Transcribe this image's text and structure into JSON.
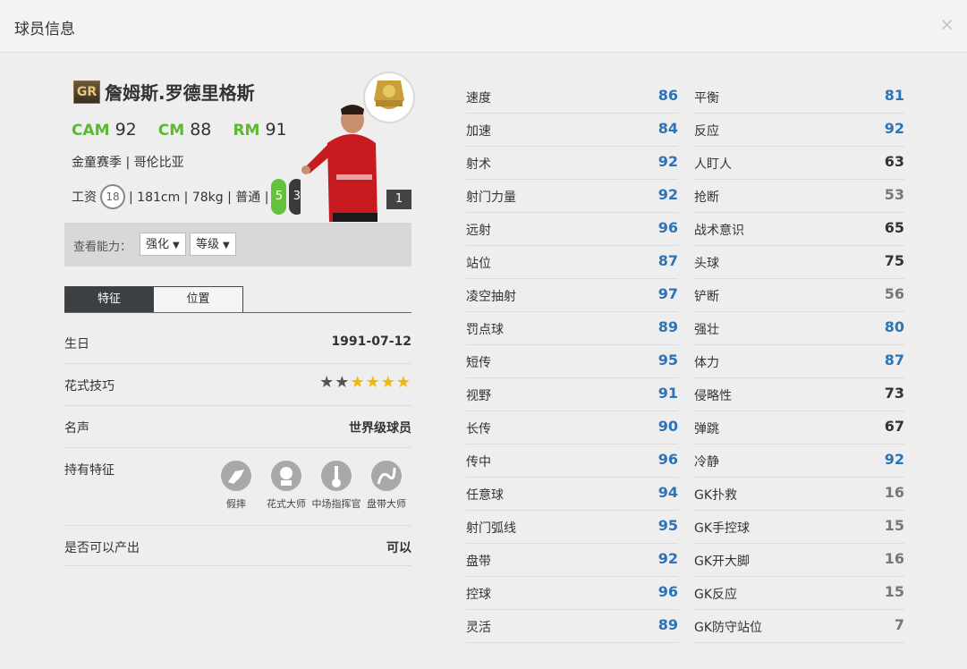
{
  "window": {
    "title": "球员信息",
    "close": "×"
  },
  "player": {
    "grade": "GR",
    "name": "詹姆斯.罗德里格斯",
    "positions": [
      {
        "code": "CAM",
        "value": "92"
      },
      {
        "code": "CM",
        "value": "88"
      },
      {
        "code": "RM",
        "value": "91"
      }
    ],
    "season_line": "金童赛季 | 哥伦比亚",
    "wage_label": "工资",
    "wage": "18",
    "body_line": "| 181cm | 78kg | 普通 |",
    "left_foot": "5",
    "right_foot": "3",
    "level": "1"
  },
  "ability": {
    "label": "查看能力：",
    "select1": "强化",
    "select2": "等级"
  },
  "tabs": {
    "active": "特征",
    "inactive": "位置"
  },
  "details": {
    "birthday_label": "生日",
    "birthday": "1991-07-12",
    "skill_label": "花式技巧",
    "skill_stars": 5,
    "skill_filled_dark": 2,
    "fame_label": "名声",
    "fame": "世界级球员",
    "traits_label": "持有特征",
    "traits": [
      "假摔",
      "花式大师",
      "中场指挥官",
      "盘带大师"
    ],
    "produce_label": "是否可以产出",
    "produce": "可以"
  },
  "stats_left": [
    {
      "name": "速度",
      "value": "86",
      "color": "blue"
    },
    {
      "name": "加速",
      "value": "84",
      "color": "blue"
    },
    {
      "name": "射术",
      "value": "92",
      "color": "blue"
    },
    {
      "name": "射门力量",
      "value": "92",
      "color": "blue"
    },
    {
      "name": "远射",
      "value": "96",
      "color": "blue"
    },
    {
      "name": "站位",
      "value": "87",
      "color": "blue"
    },
    {
      "name": "凌空抽射",
      "value": "97",
      "color": "blue"
    },
    {
      "name": "罚点球",
      "value": "89",
      "color": "blue"
    },
    {
      "name": "短传",
      "value": "95",
      "color": "blue"
    },
    {
      "name": "视野",
      "value": "91",
      "color": "blue"
    },
    {
      "name": "长传",
      "value": "90",
      "color": "blue"
    },
    {
      "name": "传中",
      "value": "96",
      "color": "blue"
    },
    {
      "name": "任意球",
      "value": "94",
      "color": "blue"
    },
    {
      "name": "射门弧线",
      "value": "95",
      "color": "blue"
    },
    {
      "name": "盘带",
      "value": "92",
      "color": "blue"
    },
    {
      "name": "控球",
      "value": "96",
      "color": "blue"
    },
    {
      "name": "灵活",
      "value": "89",
      "color": "blue"
    }
  ],
  "stats_right": [
    {
      "name": "平衡",
      "value": "81",
      "color": "blue"
    },
    {
      "name": "反应",
      "value": "92",
      "color": "blue"
    },
    {
      "name": "人盯人",
      "value": "63",
      "color": "black"
    },
    {
      "name": "抢断",
      "value": "53",
      "color": "gray"
    },
    {
      "name": "战术意识",
      "value": "65",
      "color": "black"
    },
    {
      "name": "头球",
      "value": "75",
      "color": "black"
    },
    {
      "name": "铲断",
      "value": "56",
      "color": "gray"
    },
    {
      "name": "强壮",
      "value": "80",
      "color": "blue"
    },
    {
      "name": "体力",
      "value": "87",
      "color": "blue"
    },
    {
      "name": "侵略性",
      "value": "73",
      "color": "black"
    },
    {
      "name": "弹跳",
      "value": "67",
      "color": "black"
    },
    {
      "name": "冷静",
      "value": "92",
      "color": "blue"
    },
    {
      "name": "GK扑救",
      "value": "16",
      "color": "gray"
    },
    {
      "name": "GK手控球",
      "value": "15",
      "color": "gray"
    },
    {
      "name": "GK开大脚",
      "value": "16",
      "color": "gray"
    },
    {
      "name": "GK反应",
      "value": "15",
      "color": "gray"
    },
    {
      "name": "GK防守站位",
      "value": "7",
      "color": "gray"
    }
  ]
}
